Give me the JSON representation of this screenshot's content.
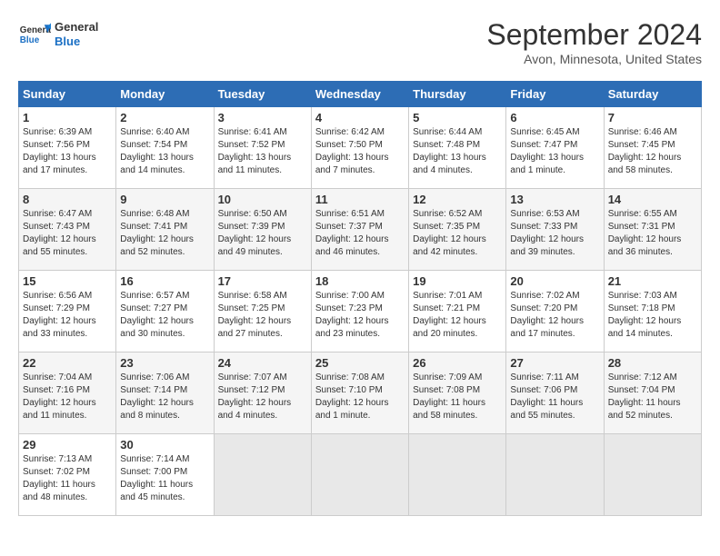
{
  "header": {
    "logo_general": "General",
    "logo_blue": "Blue",
    "title": "September 2024",
    "location": "Avon, Minnesota, United States"
  },
  "weekdays": [
    "Sunday",
    "Monday",
    "Tuesday",
    "Wednesday",
    "Thursday",
    "Friday",
    "Saturday"
  ],
  "weeks": [
    [
      {
        "day": "1",
        "info": "Sunrise: 6:39 AM\nSunset: 7:56 PM\nDaylight: 13 hours\nand 17 minutes."
      },
      {
        "day": "2",
        "info": "Sunrise: 6:40 AM\nSunset: 7:54 PM\nDaylight: 13 hours\nand 14 minutes."
      },
      {
        "day": "3",
        "info": "Sunrise: 6:41 AM\nSunset: 7:52 PM\nDaylight: 13 hours\nand 11 minutes."
      },
      {
        "day": "4",
        "info": "Sunrise: 6:42 AM\nSunset: 7:50 PM\nDaylight: 13 hours\nand 7 minutes."
      },
      {
        "day": "5",
        "info": "Sunrise: 6:44 AM\nSunset: 7:48 PM\nDaylight: 13 hours\nand 4 minutes."
      },
      {
        "day": "6",
        "info": "Sunrise: 6:45 AM\nSunset: 7:47 PM\nDaylight: 13 hours\nand 1 minute."
      },
      {
        "day": "7",
        "info": "Sunrise: 6:46 AM\nSunset: 7:45 PM\nDaylight: 12 hours\nand 58 minutes."
      }
    ],
    [
      {
        "day": "8",
        "info": "Sunrise: 6:47 AM\nSunset: 7:43 PM\nDaylight: 12 hours\nand 55 minutes."
      },
      {
        "day": "9",
        "info": "Sunrise: 6:48 AM\nSunset: 7:41 PM\nDaylight: 12 hours\nand 52 minutes."
      },
      {
        "day": "10",
        "info": "Sunrise: 6:50 AM\nSunset: 7:39 PM\nDaylight: 12 hours\nand 49 minutes."
      },
      {
        "day": "11",
        "info": "Sunrise: 6:51 AM\nSunset: 7:37 PM\nDaylight: 12 hours\nand 46 minutes."
      },
      {
        "day": "12",
        "info": "Sunrise: 6:52 AM\nSunset: 7:35 PM\nDaylight: 12 hours\nand 42 minutes."
      },
      {
        "day": "13",
        "info": "Sunrise: 6:53 AM\nSunset: 7:33 PM\nDaylight: 12 hours\nand 39 minutes."
      },
      {
        "day": "14",
        "info": "Sunrise: 6:55 AM\nSunset: 7:31 PM\nDaylight: 12 hours\nand 36 minutes."
      }
    ],
    [
      {
        "day": "15",
        "info": "Sunrise: 6:56 AM\nSunset: 7:29 PM\nDaylight: 12 hours\nand 33 minutes."
      },
      {
        "day": "16",
        "info": "Sunrise: 6:57 AM\nSunset: 7:27 PM\nDaylight: 12 hours\nand 30 minutes."
      },
      {
        "day": "17",
        "info": "Sunrise: 6:58 AM\nSunset: 7:25 PM\nDaylight: 12 hours\nand 27 minutes."
      },
      {
        "day": "18",
        "info": "Sunrise: 7:00 AM\nSunset: 7:23 PM\nDaylight: 12 hours\nand 23 minutes."
      },
      {
        "day": "19",
        "info": "Sunrise: 7:01 AM\nSunset: 7:21 PM\nDaylight: 12 hours\nand 20 minutes."
      },
      {
        "day": "20",
        "info": "Sunrise: 7:02 AM\nSunset: 7:20 PM\nDaylight: 12 hours\nand 17 minutes."
      },
      {
        "day": "21",
        "info": "Sunrise: 7:03 AM\nSunset: 7:18 PM\nDaylight: 12 hours\nand 14 minutes."
      }
    ],
    [
      {
        "day": "22",
        "info": "Sunrise: 7:04 AM\nSunset: 7:16 PM\nDaylight: 12 hours\nand 11 minutes."
      },
      {
        "day": "23",
        "info": "Sunrise: 7:06 AM\nSunset: 7:14 PM\nDaylight: 12 hours\nand 8 minutes."
      },
      {
        "day": "24",
        "info": "Sunrise: 7:07 AM\nSunset: 7:12 PM\nDaylight: 12 hours\nand 4 minutes."
      },
      {
        "day": "25",
        "info": "Sunrise: 7:08 AM\nSunset: 7:10 PM\nDaylight: 12 hours\nand 1 minute."
      },
      {
        "day": "26",
        "info": "Sunrise: 7:09 AM\nSunset: 7:08 PM\nDaylight: 11 hours\nand 58 minutes."
      },
      {
        "day": "27",
        "info": "Sunrise: 7:11 AM\nSunset: 7:06 PM\nDaylight: 11 hours\nand 55 minutes."
      },
      {
        "day": "28",
        "info": "Sunrise: 7:12 AM\nSunset: 7:04 PM\nDaylight: 11 hours\nand 52 minutes."
      }
    ],
    [
      {
        "day": "29",
        "info": "Sunrise: 7:13 AM\nSunset: 7:02 PM\nDaylight: 11 hours\nand 48 minutes."
      },
      {
        "day": "30",
        "info": "Sunrise: 7:14 AM\nSunset: 7:00 PM\nDaylight: 11 hours\nand 45 minutes."
      },
      {
        "day": "",
        "info": ""
      },
      {
        "day": "",
        "info": ""
      },
      {
        "day": "",
        "info": ""
      },
      {
        "day": "",
        "info": ""
      },
      {
        "day": "",
        "info": ""
      }
    ]
  ]
}
